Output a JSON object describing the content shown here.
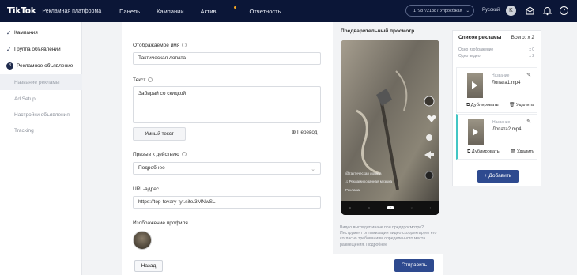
{
  "topbar": {
    "logo": "TikTok",
    "logo_sub": ": Рекламная платформа",
    "nav": [
      "Панель",
      "Кампании",
      "Актив",
      "Отчетность"
    ],
    "account": "17987/21387 Упросбжая",
    "language": "Русский",
    "avatar_letter": "K"
  },
  "sidebar": {
    "steps": [
      {
        "label": "Кампания",
        "done": true
      },
      {
        "label": "Группа объявлений",
        "done": true
      },
      {
        "label": "Рекламное объявление",
        "number": "3"
      }
    ],
    "sub_items": [
      "Название рекламы",
      "Ad Setup",
      "Настройки объявления",
      "Tracking"
    ]
  },
  "form": {
    "display_name_label": "Отображаемое имя",
    "display_name_value": "Тактическая лопата",
    "text_label": "Текст",
    "text_value": "Забирай со скидкой",
    "smart_text_button": "Умный текст",
    "translate_link": "Перевод",
    "cta_label": "Призыв к действию",
    "cta_value": "Подробнее",
    "url_label": "URL-адрес",
    "url_value": "https://top-tovary-tyt.site/3MNwSL",
    "profile_image_label": "Изображение профиля"
  },
  "footer": {
    "back_button": "Назад",
    "send_button": "Отправить"
  },
  "preview": {
    "title": "Предварительный просмотр",
    "caption_name": "@тактическая лопата",
    "caption_sound": "♫ Рекламированная музыка",
    "caption_sponsored": "Реклама",
    "note": "Видео выглядит иначе при предпросмотре? Инструмент оптимизации видео скорректирует его согласно требованиям определенного места размещения. Подробнее"
  },
  "ad_list": {
    "title": "Список рекламы",
    "total": "Всего: x 2",
    "images_label": "Одно изображение",
    "images_count": "x 0",
    "videos_label": "Одно видео",
    "videos_count": "x 2",
    "items": [
      {
        "name_label": "Название",
        "name": "Лопата1.mp4",
        "duplicate": "Дублировать",
        "delete": "Удалить"
      },
      {
        "name_label": "Название",
        "name": "Лопата2.mp4",
        "duplicate": "Дублировать",
        "delete": "Удалить"
      }
    ],
    "add_button": "+ Добавить"
  },
  "colors": {
    "topbar": "#0b1637",
    "primary_button": "#2e4a8f",
    "selected_card_accent": "#42c6c4"
  }
}
